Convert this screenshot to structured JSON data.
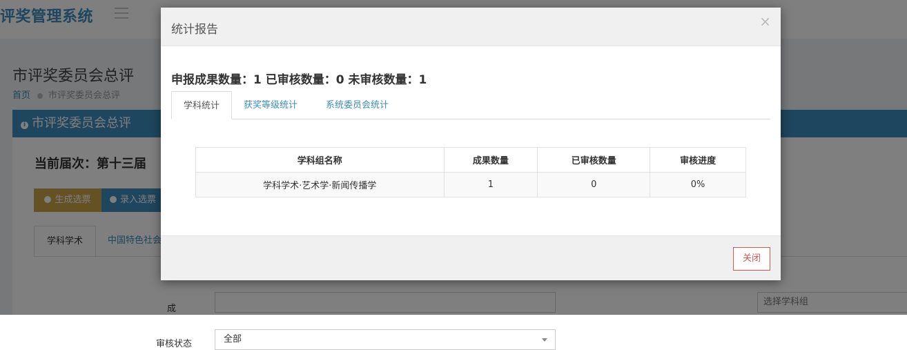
{
  "app": {
    "title": "评奖管理系统"
  },
  "page": {
    "title": "市评奖委员会总评",
    "breadcrumb": {
      "home": "首页",
      "current": "市评奖委员会总评"
    },
    "panel_title": "市评奖委员会总评",
    "session_text": "当前届次：第十三届",
    "buttons": {
      "generate": "生成选票",
      "import": "录入选票"
    },
    "tabs": [
      "学科学术",
      "中国特色社会"
    ],
    "filters": {
      "label_partial": "成",
      "status_label": "审核状态",
      "status_value": "全部",
      "subject_group_placeholder": "选择学科组"
    }
  },
  "modal": {
    "title": "统计报告",
    "close_symbol": "×",
    "summary": "申报成果数量：1 已审核数量：0 未审核数量：1",
    "tabs": [
      {
        "label": "学科统计",
        "active": true
      },
      {
        "label": "获奖等级统计",
        "active": false
      },
      {
        "label": "系统委员会统计",
        "active": false
      }
    ],
    "table": {
      "headers": [
        "学科组名称",
        "成果数量",
        "已审核数量",
        "审核进度"
      ],
      "rows": [
        [
          "学科学术·艺术学·新闻传播学",
          "1",
          "0",
          "0%"
        ]
      ]
    },
    "close_button": "关闭"
  },
  "colors": {
    "primary": "#3c8dbc",
    "warning": "#c8a349",
    "danger": "#d9534f",
    "background": "#ecf0f5"
  }
}
